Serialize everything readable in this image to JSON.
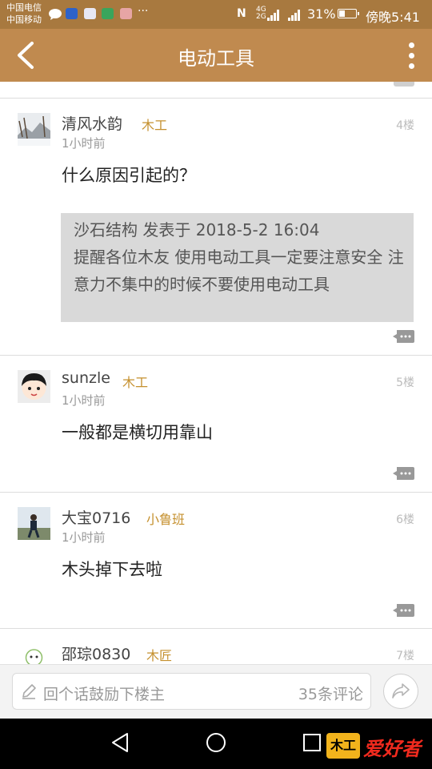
{
  "status_bar": {
    "carrier1": "中国电信",
    "carrier2": "中国移动",
    "notification_icons": [
      "chat-bubble-icon",
      "app-badge-icon",
      "app-badge-icon",
      "app-badge-icon",
      "app-badge-icon"
    ],
    "overflow": "···",
    "nfc": "N",
    "net_top": "4G",
    "net_bottom": "2G",
    "battery": "31%",
    "battery_level": 0.31,
    "time": "傍晚5:41"
  },
  "app_bar": {
    "title": "电动工具",
    "color": "#c08a4f"
  },
  "comments": [
    {
      "author": "清风水韵",
      "badge": "木工",
      "time": "1小时前",
      "floor": "4楼",
      "content": "什么原因引起的？",
      "quote": {
        "header": "沙石结构 发表于 2018-5-2 16:04",
        "body": "提醒各位木友 使用电动工具一定要注意安全 注意力不集中的时候不要使用电动工具"
      }
    },
    {
      "author": "sunzle",
      "badge": "木工",
      "time": "1小时前",
      "floor": "5楼",
      "content": "一般都是横切用靠山"
    },
    {
      "author": "大宝0716",
      "badge": "小鲁班",
      "time": "1小时前",
      "floor": "6楼",
      "content": "木头掉下去啦"
    },
    {
      "author": "邵琮0830",
      "badge": "木匠",
      "floor": "7楼"
    }
  ],
  "input_bar": {
    "placeholder": "回个话鼓励下楼主",
    "comment_count": "35条评论"
  },
  "brand": {
    "badge": "木工",
    "text": "爱好者"
  },
  "colors": {
    "badge": "#c5902e",
    "status_bar": "#a8793f"
  }
}
